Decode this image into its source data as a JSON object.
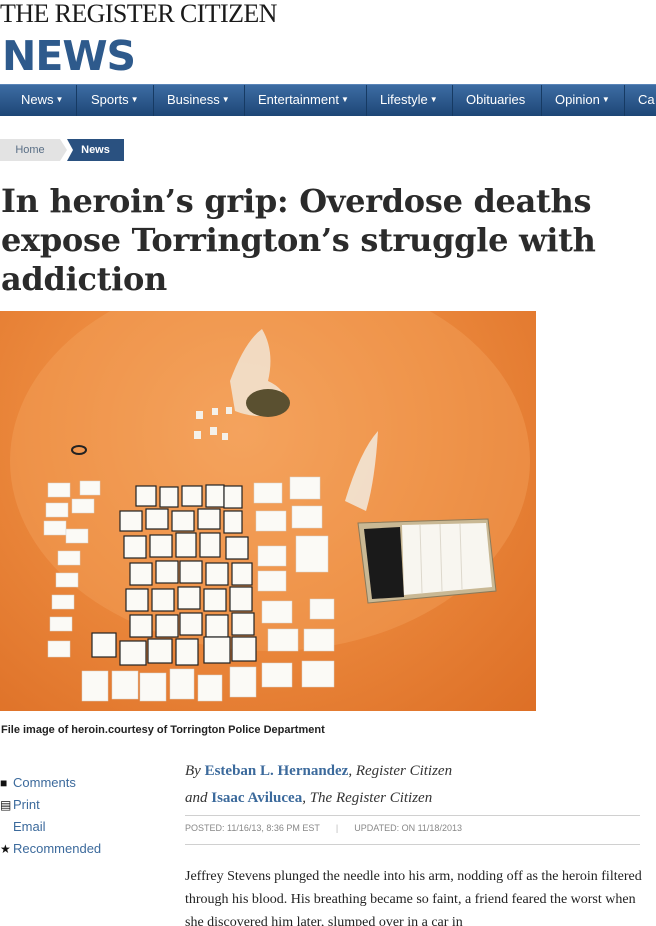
{
  "masthead": {
    "paper_name": "THE REGISTER CITIZEN",
    "section_name": "NEWS"
  },
  "nav": {
    "items": [
      {
        "label": "News",
        "has_menu": true
      },
      {
        "label": "Sports",
        "has_menu": true
      },
      {
        "label": "Business",
        "has_menu": true
      },
      {
        "label": "Entertainment",
        "has_menu": true
      },
      {
        "label": "Lifestyle",
        "has_menu": true
      },
      {
        "label": "Obituaries",
        "has_menu": false
      },
      {
        "label": "Opinion",
        "has_menu": true
      },
      {
        "label": "Ca",
        "has_menu": false
      }
    ]
  },
  "breadcrumb": {
    "home": "Home",
    "current": "News"
  },
  "article": {
    "headline": "In heroin’s grip: Overdose deaths expose Torrington’s struggle with addiction",
    "photo_caption": "File image of heroin.courtesy of Torrington Police Department",
    "byline": {
      "by": "By",
      "author1": "Esteban L. Hernandez",
      "affil1": ", Register Citizen",
      "and": "and",
      "author2": "Isaac Avilucea",
      "affil2": ", The Register Citizen"
    },
    "posted": "POSTED: 11/16/13, 8:36 PM EST",
    "updated": "UPDATED: ON 11/18/2013",
    "meta_sep": "|",
    "body": "Jeffrey Stevens plunged the needle into his arm, nodding off as the heroin filtered through his blood. His breathing became so faint, a friend feared the worst when she discovered him later, slumped over in a car in"
  },
  "tools": {
    "comments": "Comments",
    "print": "Print",
    "email": "Email",
    "recommended": "Recommended"
  },
  "colors": {
    "nav_bg": "#2a5180",
    "link": "#3c6a9c",
    "news_blue": "#2e5a8c",
    "photo_bg": "#ec8a3e"
  }
}
